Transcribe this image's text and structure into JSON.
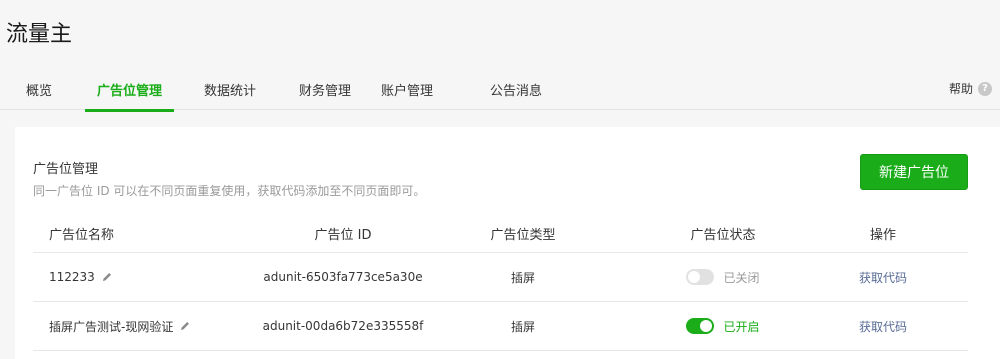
{
  "app_title": "流量主",
  "tabs": [
    {
      "label": "概览",
      "active": false
    },
    {
      "label": "广告位管理",
      "active": true
    },
    {
      "label": "数据统计",
      "active": false
    },
    {
      "label": "财务管理",
      "active": false
    },
    {
      "label": "账户管理",
      "active": false
    },
    {
      "label": "公告消息",
      "active": false
    }
  ],
  "help": {
    "label": "帮助",
    "icon": "question-circle-icon"
  },
  "section": {
    "title": "广告位管理",
    "description": "同一广告位 ID 可以在不同页面重复使用，获取代码添加至不同页面即可。",
    "new_button": "新建广告位"
  },
  "table": {
    "headers": [
      "广告位名称",
      "广告位 ID",
      "广告位类型",
      "广告位状态",
      "操作"
    ],
    "rows": [
      {
        "name": "112233",
        "id": "adunit-6503fa773ce5a30e",
        "type": "插屏",
        "status": "已关闭",
        "enabled": false,
        "action": "获取代码"
      },
      {
        "name": "插屏广告测试-现网验证",
        "id": "adunit-00da6b72e335558f",
        "type": "插屏",
        "status": "已开启",
        "enabled": true,
        "action": "获取代码"
      }
    ]
  },
  "colors": {
    "accent": "#1aad19",
    "link": "#576b95",
    "muted": "#9a9a9a"
  }
}
